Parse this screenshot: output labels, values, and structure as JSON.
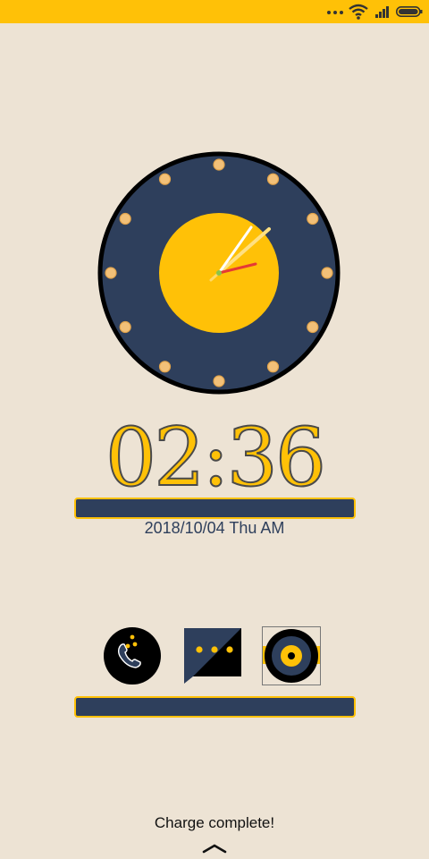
{
  "status_bar": {
    "icons": [
      "more-dots-icon",
      "wifi-icon",
      "signal-icon",
      "battery-icon"
    ],
    "background": "#ffc107"
  },
  "clock": {
    "analog_time": "02:36",
    "face_color": "#2e3f5c",
    "center_color": "#ffc107",
    "second_hand_color": "#e53935"
  },
  "lockscreen": {
    "time": "02:36",
    "date": "2018/10/04 Thu AM",
    "charge_status": "Charge complete!"
  },
  "shortcuts": [
    {
      "name": "phone",
      "icon": "phone-icon"
    },
    {
      "name": "messages",
      "icon": "message-icon"
    },
    {
      "name": "music",
      "icon": "music-disc-icon"
    }
  ],
  "colors": {
    "accent": "#ffc107",
    "navy": "#2e3f5c",
    "background": "#ede3d4"
  }
}
